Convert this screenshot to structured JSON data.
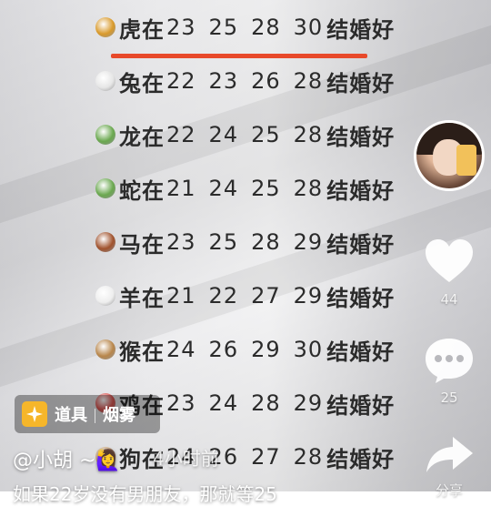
{
  "rows": [
    {
      "animal": "tiger-icon",
      "text": "虎在",
      "nums": [
        "23",
        "25",
        "28",
        "30"
      ],
      "suffix": "结婚好",
      "color": "#d99a2b"
    },
    {
      "animal": "rabbit-icon",
      "text": "兔在",
      "nums": [
        "22",
        "23",
        "26",
        "28"
      ],
      "suffix": "结婚好",
      "color": "#e6e6e6"
    },
    {
      "animal": "dragon-icon",
      "text": "龙在",
      "nums": [
        "22",
        "24",
        "25",
        "28"
      ],
      "suffix": "结婚好",
      "color": "#6aa84f"
    },
    {
      "animal": "snake-icon",
      "text": "蛇在",
      "nums": [
        "21",
        "24",
        "25",
        "28"
      ],
      "suffix": "结婚好",
      "color": "#6aa84f"
    },
    {
      "animal": "horse-icon",
      "text": "马在",
      "nums": [
        "23",
        "25",
        "28",
        "29"
      ],
      "suffix": "结婚好",
      "color": "#a0522d"
    },
    {
      "animal": "sheep-icon",
      "text": "羊在",
      "nums": [
        "21",
        "22",
        "27",
        "29"
      ],
      "suffix": "结婚好",
      "color": "#eeeeee"
    },
    {
      "animal": "monkey-icon",
      "text": "猴在",
      "nums": [
        "24",
        "26",
        "29",
        "30"
      ],
      "suffix": "结婚好",
      "color": "#b8864b"
    },
    {
      "animal": "rooster-icon",
      "text": "鸡在",
      "nums": [
        "23",
        "24",
        "28",
        "29"
      ],
      "suffix": "结婚好",
      "color": "#d9534f"
    },
    {
      "animal": "dog-icon",
      "text": "狗在",
      "nums": [
        "24",
        "26",
        "27",
        "28"
      ],
      "suffix": "结婚好",
      "color": "#c8a27a"
    }
  ],
  "sidebar": {
    "likes": "44",
    "comments": "25",
    "share_label": "分享"
  },
  "tool": {
    "label": "道具",
    "name": "烟雾"
  },
  "author": {
    "name": "@小胡 ~🙋‍♀️",
    "time": "4小时前"
  },
  "caption": "如果22岁没有男朋友，那就等25",
  "colors": {
    "accent_line": "#e8492a",
    "tool_icon": "#f6b62a"
  }
}
